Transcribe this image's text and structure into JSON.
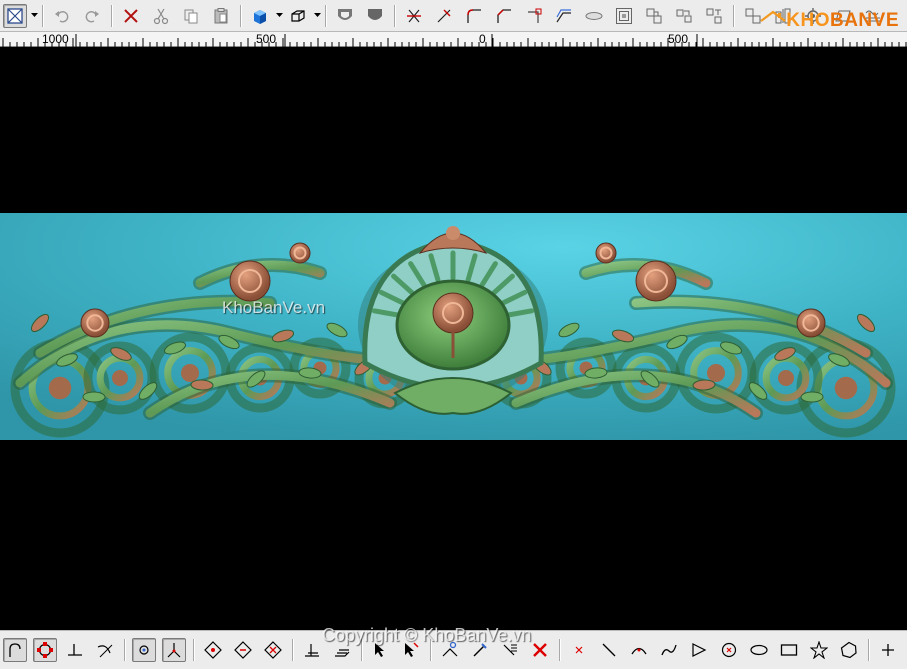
{
  "ruler": {
    "labels": [
      "1000",
      "500",
      "0",
      "500"
    ]
  },
  "watermarks": {
    "viewport": "KhoBanVe.vn",
    "footer": "Copyright © KhoBanVe.vn"
  },
  "logo": {
    "text": "KHOBANVE"
  },
  "colors": {
    "toolbar_bg": "#ececec",
    "viewport_bg": "#000000",
    "relief_background": "#3fb3c6",
    "ornament_green": "#5d9a55",
    "ornament_copper": "#b9785a"
  },
  "top_toolbar": {
    "icons": [
      "view-select-icon",
      "dropdown-arrow-icon",
      "undo-icon",
      "redo-icon",
      "delete-icon",
      "cut-icon",
      "copy-icon",
      "paste-icon",
      "shaded-view-icon",
      "dropdown-arrow-icon",
      "wireframe-box-icon",
      "dropdown-arrow-icon",
      "shield-outline-icon",
      "shield-filled-icon",
      "trim-icon",
      "extend-icon",
      "fillet-icon",
      "chamfer-icon",
      "corner-icon",
      "offset-icon",
      "ellipse-icon",
      "nested-squares-icon",
      "group-icon",
      "ungroup-icon",
      "array-icon",
      "align-icon",
      "distribute-icon",
      "gear-icon",
      "parallelogram-icon",
      "wave-icon"
    ]
  },
  "bottom_toolbar": {
    "icons": [
      "arc-snap-icon",
      "circle-snap-icon",
      "perpendicular-icon",
      "tangent-icon",
      "grid-snap-icon",
      "axis-icon",
      "diamond-node-icon",
      "diamond-edit-icon",
      "diamond-delete-icon",
      "layer-icon",
      "stack-icon",
      "select-node-icon",
      "move-node-icon",
      "link-icon",
      "edit-list-icon",
      "delete-x-icon",
      "point-icon",
      "line-icon",
      "arc-icon",
      "polyline-icon",
      "triangle-icon",
      "circle-center-icon",
      "ellipse-tool-icon",
      "rectangle-icon",
      "star-icon",
      "polygon-icon",
      "cross-icon",
      "dimension-icon"
    ]
  }
}
